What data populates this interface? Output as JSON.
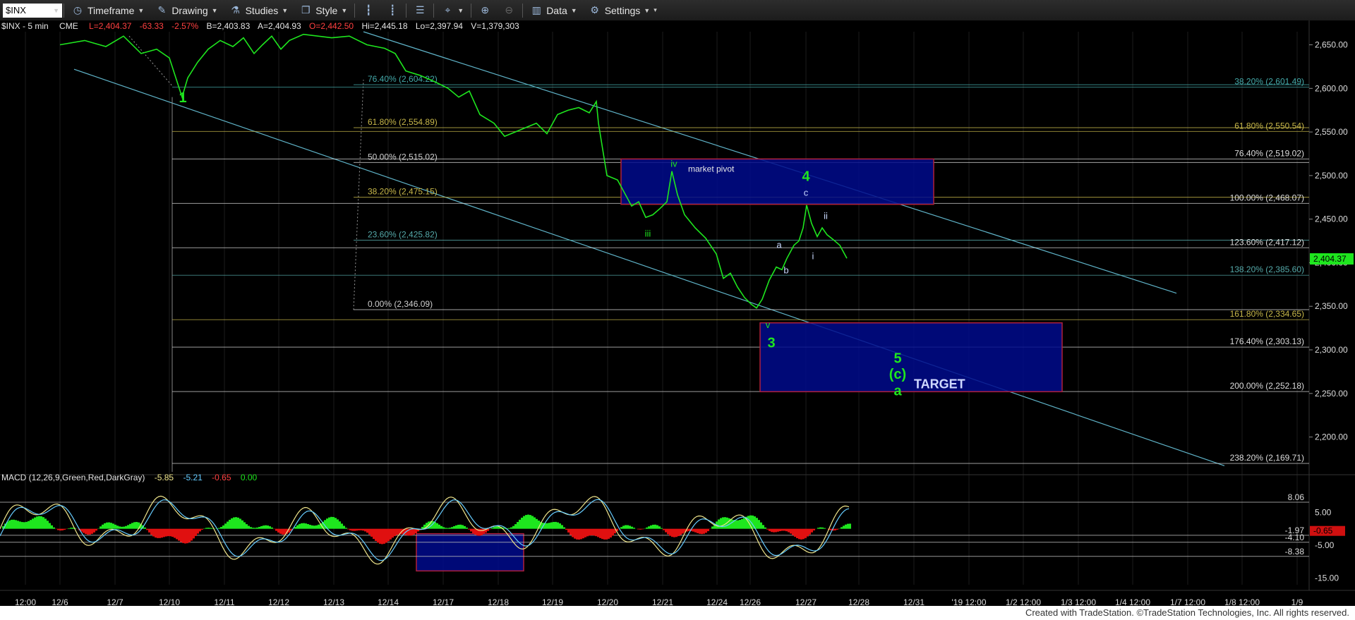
{
  "toolbar": {
    "symbol": "$INX",
    "items": [
      {
        "name": "timeframe-button",
        "icon": "clock-icon",
        "label": "Timeframe"
      },
      {
        "name": "drawing-button",
        "icon": "pencil-icon",
        "label": "Drawing"
      },
      {
        "name": "studies-button",
        "icon": "flask-icon",
        "label": "Studies"
      },
      {
        "name": "style-button",
        "icon": "style-icon",
        "label": "Style"
      },
      {
        "name": "data-button",
        "icon": "bars-icon",
        "label": "Data"
      },
      {
        "name": "settings-button",
        "icon": "gear-icon",
        "label": "Settings"
      }
    ]
  },
  "status_line": {
    "symbol": "$INX - 5 min",
    "source": "CME",
    "last": "L=2,404.37",
    "change": "-63.33",
    "change_pct": "-2.57%",
    "bid": "B=2,403.83",
    "ask": "A=2,404.93",
    "open": "O=2,442.50",
    "high": "Hi=2,445.18",
    "low": "Lo=2,397.94",
    "volume": "V=1,379,303"
  },
  "macd_status": {
    "label": "MACD (12,26,9,Green,Red,DarkGray)",
    "v1": "-5.85",
    "v2": "-5.21",
    "v3": "-0.65",
    "v4": "0.00"
  },
  "footer": "Created with TradeStation. ©TradeStation Technologies, Inc. All rights reserved.",
  "chart_data": {
    "type": "line",
    "title": "$INX - 5 min",
    "price_axis": {
      "ylim": [
        2160,
        2665
      ],
      "ticks": [
        2650,
        2600,
        2550,
        2500,
        2450,
        2400,
        2350,
        2300,
        2250,
        2200
      ],
      "tick_labels": [
        "2,650.00",
        "2,600.00",
        "2,550.00",
        "2,500.00",
        "2,450.00",
        "2,400.00",
        "2,350.00",
        "2,300.00",
        "2,250.00",
        "2,200.00"
      ],
      "last_price_label": "2,404.37",
      "last_price": 2404.37
    },
    "x_axis": {
      "range": [
        0,
        1920
      ],
      "ticks": [
        {
          "label": "12:00",
          "x": 36
        },
        {
          "label": "12/6",
          "x": 85
        },
        {
          "label": "12/7",
          "x": 163
        },
        {
          "label": "12/10",
          "x": 240
        },
        {
          "label": "12/11",
          "x": 318
        },
        {
          "label": "12/12",
          "x": 395
        },
        {
          "label": "12/13",
          "x": 473
        },
        {
          "label": "12/14",
          "x": 550
        },
        {
          "label": "12/17",
          "x": 628
        },
        {
          "label": "12/18",
          "x": 706
        },
        {
          "label": "12/19",
          "x": 783
        },
        {
          "label": "12/20",
          "x": 861
        },
        {
          "label": "12/21",
          "x": 939
        },
        {
          "label": "12/24",
          "x": 1016
        },
        {
          "label": "12/26",
          "x": 1063
        },
        {
          "label": "12/27",
          "x": 1142
        },
        {
          "label": "12/28",
          "x": 1217
        },
        {
          "label": "12/31",
          "x": 1295
        },
        {
          "label": "'19 12:00",
          "x": 1373
        },
        {
          "label": "1/2 12:00",
          "x": 1450
        },
        {
          "label": "1/3 12:00",
          "x": 1528
        },
        {
          "label": "1/4 12:00",
          "x": 1605
        },
        {
          "label": "1/7 12:00",
          "x": 1683
        },
        {
          "label": "1/8 12:00",
          "x": 1760
        },
        {
          "label": "1/9",
          "x": 1838
        }
      ]
    },
    "series": [
      {
        "color": "#1ee61e",
        "points": [
          [
            85,
            2650
          ],
          [
            120,
            2655
          ],
          [
            150,
            2648
          ],
          [
            175,
            2660
          ],
          [
            200,
            2640
          ],
          [
            222,
            2645
          ],
          [
            240,
            2635
          ],
          [
            250,
            2610
          ],
          [
            258,
            2590
          ],
          [
            266,
            2612
          ],
          [
            280,
            2630
          ],
          [
            295,
            2645
          ],
          [
            312,
            2655
          ],
          [
            330,
            2648
          ],
          [
            345,
            2658
          ],
          [
            360,
            2640
          ],
          [
            372,
            2650
          ],
          [
            385,
            2660
          ],
          [
            398,
            2645
          ],
          [
            410,
            2655
          ],
          [
            430,
            2662
          ],
          [
            470,
            2658
          ],
          [
            495,
            2660
          ],
          [
            520,
            2650
          ],
          [
            545,
            2646
          ],
          [
            560,
            2640
          ],
          [
            575,
            2620
          ],
          [
            595,
            2615
          ],
          [
            615,
            2608
          ],
          [
            635,
            2600
          ],
          [
            650,
            2590
          ],
          [
            665,
            2597
          ],
          [
            680,
            2570
          ],
          [
            700,
            2560
          ],
          [
            715,
            2545
          ],
          [
            730,
            2550
          ],
          [
            745,
            2555
          ],
          [
            760,
            2560
          ],
          [
            775,
            2548
          ],
          [
            790,
            2570
          ],
          [
            805,
            2575
          ],
          [
            820,
            2578
          ],
          [
            835,
            2572
          ],
          [
            845,
            2585
          ],
          [
            848,
            2560
          ],
          [
            860,
            2500
          ],
          [
            875,
            2495
          ],
          [
            885,
            2480
          ],
          [
            895,
            2465
          ],
          [
            905,
            2470
          ],
          [
            915,
            2452
          ],
          [
            925,
            2455
          ],
          [
            935,
            2462
          ],
          [
            945,
            2470
          ],
          [
            952,
            2505
          ],
          [
            960,
            2478
          ],
          [
            970,
            2455
          ],
          [
            985,
            2440
          ],
          [
            1000,
            2428
          ],
          [
            1015,
            2410
          ],
          [
            1025,
            2382
          ],
          [
            1035,
            2388
          ],
          [
            1045,
            2372
          ],
          [
            1055,
            2360
          ],
          [
            1065,
            2352
          ],
          [
            1072,
            2348
          ],
          [
            1080,
            2358
          ],
          [
            1090,
            2380
          ],
          [
            1100,
            2395
          ],
          [
            1108,
            2392
          ],
          [
            1115,
            2405
          ],
          [
            1125,
            2420
          ],
          [
            1132,
            2425
          ],
          [
            1138,
            2440
          ],
          [
            1143,
            2466
          ],
          [
            1150,
            2445
          ],
          [
            1158,
            2430
          ],
          [
            1165,
            2440
          ],
          [
            1172,
            2432
          ],
          [
            1180,
            2427
          ],
          [
            1190,
            2420
          ],
          [
            1200,
            2405
          ]
        ]
      }
    ],
    "fib_left": [
      {
        "label": "76.40% (2,604.22)",
        "value": 2604.22
      },
      {
        "label": "61.80% (2,554.89)",
        "value": 2554.89
      },
      {
        "label": "50.00% (2,515.02)",
        "value": 2515.02
      },
      {
        "label": "38.20% (2,475.15)",
        "value": 2475.15
      },
      {
        "label": "23.60% (2,425.82)",
        "value": 2425.82
      },
      {
        "label": "0.00% (2,346.09)",
        "value": 2346.09
      }
    ],
    "fib_right": [
      {
        "label": "38.20% (2,601.49)",
        "value": 2601.49
      },
      {
        "label": "61.80% (2,550.54)",
        "value": 2550.54
      },
      {
        "label": "76.40% (2,519.02)",
        "value": 2519.02
      },
      {
        "label": "100.00% (2,468.07)",
        "value": 2468.07
      },
      {
        "label": "123.60% (2,417.12)",
        "value": 2417.12
      },
      {
        "label": "138.20% (2,385.60)",
        "value": 2385.6
      },
      {
        "label": "161.80% (2,334.65)",
        "value": 2334.65
      },
      {
        "label": "176.40% (2,303.13)",
        "value": 2303.13
      },
      {
        "label": "200.00% (2,252.18)",
        "value": 2252.18
      },
      {
        "label": "238.20% (2,169.71)",
        "value": 2169.71
      }
    ],
    "boxes": [
      {
        "label": "market pivot",
        "x0": 880,
        "x1": 1323,
        "y0": 2467,
        "y1": 2519
      },
      {
        "label": "TARGET",
        "x0": 1077,
        "x1": 1505,
        "y0": 2252,
        "y1": 2331
      }
    ],
    "wave_labels": [
      {
        "text": "1",
        "x": 259,
        "y": 2584,
        "color": "#1ee61e",
        "size": "big"
      },
      {
        "text": "iii",
        "x": 918,
        "y": 2430,
        "color": "#1ee61e",
        "size": "small"
      },
      {
        "text": "iv",
        "x": 955,
        "y": 2510,
        "color": "#1ee61e",
        "size": "small"
      },
      {
        "text": "4",
        "x": 1142,
        "y": 2494,
        "color": "#1ee61e",
        "size": "big"
      },
      {
        "text": "3",
        "x": 1093,
        "y": 2303,
        "color": "#1ee61e",
        "size": "big"
      },
      {
        "text": "v",
        "x": 1088,
        "y": 2325,
        "color": "#1ee61e",
        "size": "small"
      },
      {
        "text": "5",
        "x": 1272,
        "y": 2285,
        "color": "#1ee61e",
        "size": "big"
      },
      {
        "text": "(c)",
        "x": 1272,
        "y": 2267,
        "color": "#1ee61e",
        "size": "big"
      },
      {
        "text": "a",
        "x": 1272,
        "y": 2248,
        "color": "#1ee61e",
        "size": "big"
      },
      {
        "text": "a",
        "x": 1104,
        "y": 2417,
        "color": "#c8d8ff",
        "size": "small"
      },
      {
        "text": "b",
        "x": 1114,
        "y": 2388,
        "color": "#c8d8ff",
        "size": "small"
      },
      {
        "text": "c",
        "x": 1142,
        "y": 2477,
        "color": "#c8d8ff",
        "size": "small"
      },
      {
        "text": "i",
        "x": 1152,
        "y": 2404,
        "color": "#c8d8ff",
        "size": "small"
      },
      {
        "text": "ii",
        "x": 1170,
        "y": 2450,
        "color": "#c8d8ff",
        "size": "small"
      }
    ],
    "macd_axis": {
      "ylim": [
        -17,
        13
      ],
      "ticks": [
        5,
        -5,
        -15
      ],
      "tick_labels": [
        "5.00",
        "-5.00",
        "-15.00"
      ],
      "level_labels": [
        {
          "label": "8.06",
          "value": 8.06
        },
        {
          "label": "-1.97",
          "value": -1.97
        },
        {
          "label": "-4.10",
          "value": -4.1
        },
        {
          "label": "-8.38",
          "value": -8.38
        }
      ],
      "last_hist_label": "-0.65"
    }
  }
}
